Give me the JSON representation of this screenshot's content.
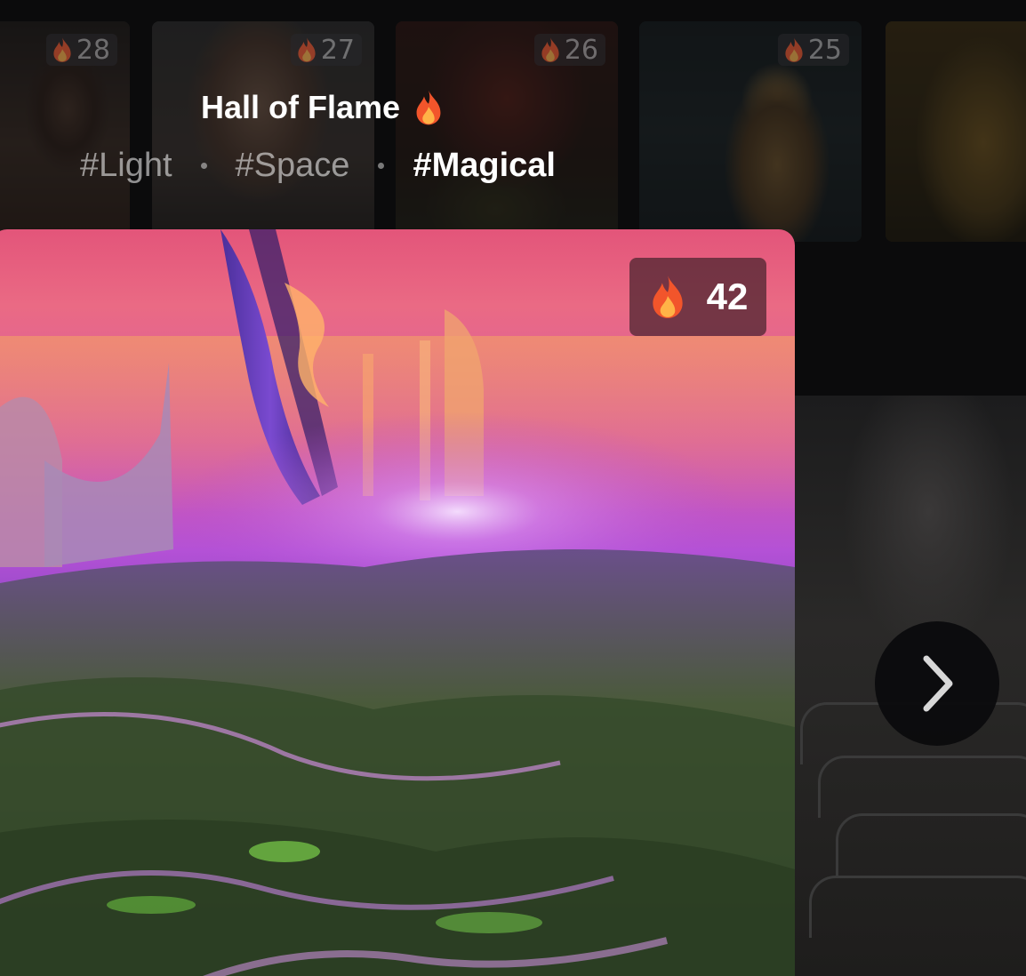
{
  "hall": {
    "title": "Hall of Flame",
    "title_icon": "flame-icon",
    "tags": [
      {
        "label": "#Light",
        "active": false
      },
      {
        "label": "#Space",
        "active": false
      },
      {
        "label": "#Magical",
        "active": true
      }
    ]
  },
  "thumbnails": [
    {
      "rank": "28"
    },
    {
      "rank": "27"
    },
    {
      "rank": "26"
    },
    {
      "rank": "25"
    },
    {
      "rank": ""
    }
  ],
  "featured": {
    "fire_count": "42",
    "fire_icon": "flame-icon"
  },
  "navigation": {
    "next_icon": "chevron-right-icon"
  },
  "colors": {
    "flame_outer": "#f2552b",
    "flame_inner": "#ffb347",
    "badge_bg": "#46232d",
    "active_tag": "#ffffff",
    "inactive_tag": "#8c8c8c"
  }
}
